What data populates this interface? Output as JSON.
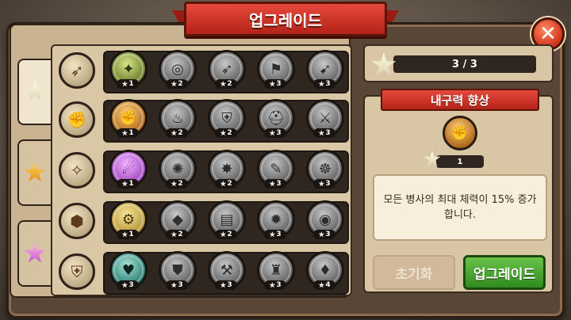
{
  "window": {
    "title": "업그레이드",
    "close_icon": "✕"
  },
  "tabs": [
    {
      "name": "star-tab-white",
      "icon": "white-star-icon"
    },
    {
      "name": "star-tab-gold",
      "icon": "gold-star-icon"
    },
    {
      "name": "star-tab-pink",
      "icon": "pink-star-icon"
    }
  ],
  "rows": [
    {
      "icon": "bow-icon",
      "skills": [
        {
          "state": "owned-green",
          "glyph": "✦",
          "cost": "1"
        },
        {
          "state": "locked",
          "glyph": "◎",
          "cost": "2"
        },
        {
          "state": "locked",
          "glyph": "➶",
          "cost": "2"
        },
        {
          "state": "locked",
          "glyph": "⚑",
          "cost": "3"
        },
        {
          "state": "locked",
          "glyph": "➹",
          "cost": "3"
        }
      ]
    },
    {
      "icon": "fist-icon",
      "skills": [
        {
          "state": "owned-orange",
          "glyph": "✊",
          "cost": "1"
        },
        {
          "state": "locked",
          "glyph": "♨",
          "cost": "2"
        },
        {
          "state": "locked",
          "glyph": "⛨",
          "cost": "2"
        },
        {
          "state": "locked",
          "glyph": "⛑",
          "cost": "3"
        },
        {
          "state": "locked",
          "glyph": "⚔",
          "cost": "3"
        }
      ]
    },
    {
      "icon": "magic-wand-icon",
      "skills": [
        {
          "state": "owned-pink",
          "glyph": "☄",
          "cost": "1"
        },
        {
          "state": "locked",
          "glyph": "✺",
          "cost": "2"
        },
        {
          "state": "locked",
          "glyph": "✸",
          "cost": "2"
        },
        {
          "state": "locked",
          "glyph": "✎",
          "cost": "3"
        },
        {
          "state": "locked",
          "glyph": "☸",
          "cost": "3"
        }
      ]
    },
    {
      "icon": "rock-icon",
      "skills": [
        {
          "state": "owned-gold",
          "glyph": "⚙",
          "cost": "1"
        },
        {
          "state": "locked",
          "glyph": "◆",
          "cost": "2"
        },
        {
          "state": "locked",
          "glyph": "▤",
          "cost": "2"
        },
        {
          "state": "locked",
          "glyph": "✹",
          "cost": "3"
        },
        {
          "state": "locked",
          "glyph": "◉",
          "cost": "3"
        }
      ]
    },
    {
      "icon": "knight-helmet-icon",
      "skills": [
        {
          "state": "owned-cyan",
          "glyph": "♥",
          "cost": "3"
        },
        {
          "state": "locked",
          "glyph": "⛊",
          "cost": "3"
        },
        {
          "state": "locked",
          "glyph": "⚒",
          "cost": "3"
        },
        {
          "state": "locked",
          "glyph": "♜",
          "cost": "3"
        },
        {
          "state": "locked",
          "glyph": "♦",
          "cost": "4"
        }
      ]
    }
  ],
  "star_count": {
    "value": "3 / 3"
  },
  "detail": {
    "title": "내구력 향상",
    "icon_glyph": "✊",
    "cost": "1",
    "description": "모든 병사의 최대 체력이 15% 증가합니다."
  },
  "buttons": {
    "reset_label": "초기화",
    "upgrade_label": "업그레이드"
  }
}
